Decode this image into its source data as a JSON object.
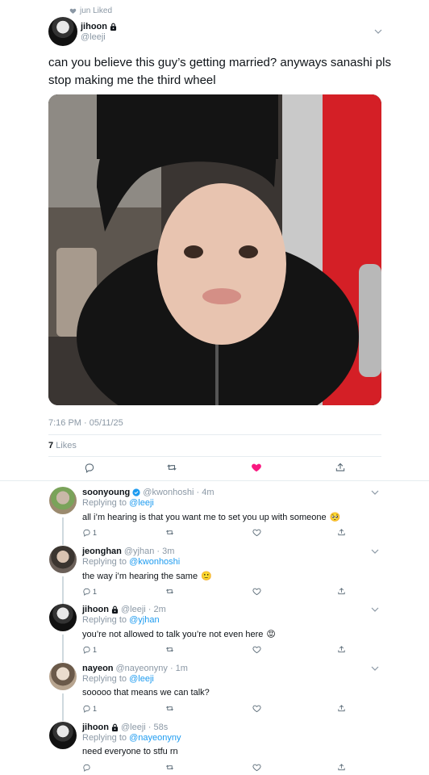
{
  "social_context": "jun Liked",
  "tweet": {
    "name": "jihoon",
    "handle": "@leeji",
    "text": "can you believe this guy’s getting married? anyways sanashi pls stop making me the third wheel",
    "timestamp": "7:16 PM · 05/11/25",
    "likes_count": "7",
    "likes_label": "Likes"
  },
  "replies": [
    {
      "name": "soonyoung",
      "verified": true,
      "handle_time": "@kwonhoshi · 4m",
      "replying_prefix": "Replying to ",
      "replying_to": "@leeji",
      "text": "all i’m hearing is that you want me to set you up with someone",
      "emoji": "🥺",
      "reply_count": "1"
    },
    {
      "name": "jeonghan",
      "handle_time": "@yjhan · 3m",
      "replying_prefix": "Replying to ",
      "replying_to": "@kwonhoshi",
      "text": "the way i’m hearing the same",
      "emoji": "🙂",
      "reply_count": "1"
    },
    {
      "name": "jihoon",
      "locked": true,
      "handle_time": "@leeji · 2m",
      "replying_prefix": "Replying to ",
      "replying_to": "@yjhan",
      "text": "you’re not allowed to talk you’re not even here",
      "emoji": "😡",
      "reply_count": "1"
    },
    {
      "name": "nayeon",
      "handle_time": "@nayeonyny · 1m",
      "replying_prefix": "Replying to ",
      "replying_to": "@leeji",
      "text": "sooooo that means we can talk?",
      "reply_count": "1"
    },
    {
      "name": "jihoon",
      "locked": true,
      "handle_time": "@leeji · 58s",
      "replying_prefix": "Replying to ",
      "replying_to": "@nayeonyny",
      "text": "need everyone to stfu rn",
      "reply_count": ""
    }
  ],
  "colors": {
    "accent": "#1d9bf0",
    "like_active": "#f91880",
    "muted": "#8b98a5"
  },
  "icons": [
    "heart-icon",
    "lock-icon",
    "chevron-down-icon",
    "reply-icon",
    "retweet-icon",
    "share-icon",
    "verified-icon"
  ]
}
